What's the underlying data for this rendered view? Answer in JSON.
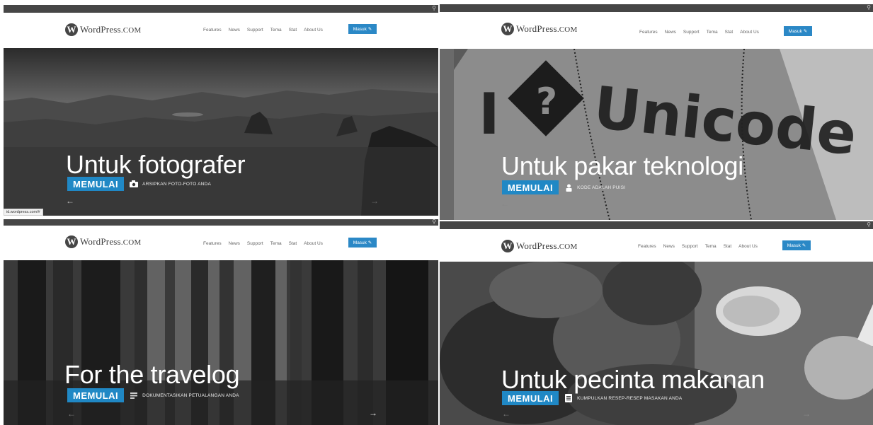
{
  "brand": {
    "mark": "W",
    "name_big": "WordPress",
    "name_small": ".COM"
  },
  "nav": [
    "Features",
    "News",
    "Support",
    "Tema",
    "Stat",
    "About Us"
  ],
  "login_label": "Masuk",
  "search_icon": "magnifier-icon",
  "status_url": "id.wordpress.com/#",
  "slides": [
    {
      "headline": "Untuk fotografer",
      "cta": "MEMULAI",
      "icon": "camera-icon",
      "caption": "ARSIPKAN FOTO-FOTO ANDA"
    },
    {
      "headline": "Untuk pakar teknologi",
      "cta": "MEMULAI",
      "icon": "person-icon",
      "caption": "KODE ADALAH PUISI"
    },
    {
      "headline": "For the travelog",
      "cta": "MEMULAI",
      "icon": "document-icon",
      "caption": "DOKUMENTASIKAN PETUALANGAN ANDA"
    },
    {
      "headline": "Untuk pecinta makanan",
      "cta": "MEMULAI",
      "icon": "recipe-icon",
      "caption": "KUMPULKAN RESEP-RESEP MASAKAN ANDA"
    }
  ],
  "background_text": "Unicode",
  "colors": {
    "accent": "#2088c5",
    "adminbar": "#464646"
  }
}
